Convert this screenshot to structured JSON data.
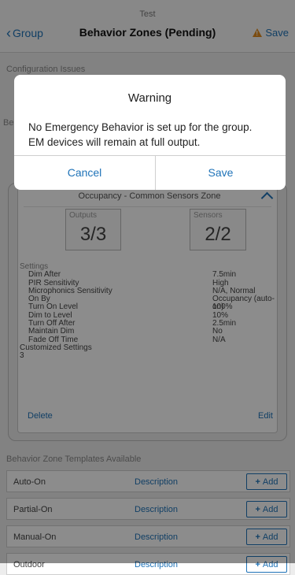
{
  "header": {
    "subtitle": "Test",
    "back_label": "Group",
    "title": "Behavior Zones (Pending)",
    "save_label": "Save"
  },
  "background": {
    "config_issues_label": "Configuration Issues",
    "behavior_zones_label": "Be"
  },
  "zone": {
    "title": "Occupancy - Common Sensors Zone",
    "outputs_label": "Outputs",
    "outputs_value": "3/3",
    "sensors_label": "Sensors",
    "sensors_value": "2/2",
    "settings_label": "Settings",
    "settings": [
      {
        "name": "Dim After",
        "value": "7.5min"
      },
      {
        "name": "PIR Sensitivity",
        "value": "High"
      },
      {
        "name": "Microphonics Sensitivity",
        "value": "N/A, Normal"
      },
      {
        "name": "On By",
        "value": "Occupancy (auto-on)"
      },
      {
        "name": "Turn On Level",
        "value": "100%"
      },
      {
        "name": "Dim to Level",
        "value": "10%"
      },
      {
        "name": "Turn Off After",
        "value": "2.5min"
      },
      {
        "name": "Maintain Dim",
        "value": "No"
      },
      {
        "name": "Fade Off Time",
        "value": "N/A"
      }
    ],
    "customized_label": "Customized Settings",
    "customized_value": "3",
    "delete_label": "Delete",
    "edit_label": "Edit"
  },
  "templates": {
    "label": "Behavior Zone Templates Available",
    "items": [
      {
        "name": "Auto-On",
        "description": "Description",
        "add": "Add"
      },
      {
        "name": "Partial-On",
        "description": "Description",
        "add": "Add"
      },
      {
        "name": "Manual-On",
        "description": "Description",
        "add": "Add"
      },
      {
        "name": "Outdoor",
        "description": "Description",
        "add": "Add"
      }
    ]
  },
  "dialog": {
    "title": "Warning",
    "message_line1": "No Emergency Behavior is set up for the group.",
    "message_line2": "EM devices will remain at full output.",
    "cancel_label": "Cancel",
    "save_label": "Save"
  },
  "colors": {
    "accent": "#1f73b8",
    "warning": "#e08a1e"
  }
}
